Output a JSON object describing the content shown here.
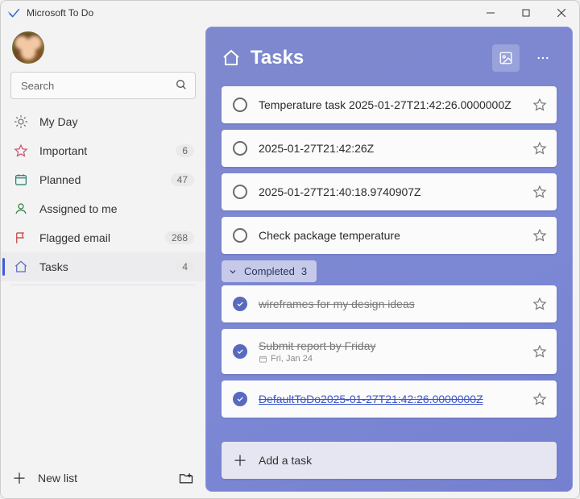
{
  "window": {
    "title": "Microsoft To Do"
  },
  "search": {
    "placeholder": "Search"
  },
  "sidebar": {
    "items": [
      {
        "icon": "sun",
        "label": "My Day",
        "count": ""
      },
      {
        "icon": "star",
        "label": "Important",
        "count": "6"
      },
      {
        "icon": "grid",
        "label": "Planned",
        "count": "47"
      },
      {
        "icon": "person",
        "label": "Assigned to me",
        "count": ""
      },
      {
        "icon": "flag",
        "label": "Flagged email",
        "count": "268"
      },
      {
        "icon": "home",
        "label": "Tasks",
        "count": "4"
      }
    ],
    "newList": "New list"
  },
  "main": {
    "title": "Tasks",
    "tasks": [
      {
        "title": "Temperature task 2025-01-27T21:42:26.0000000Z"
      },
      {
        "title": "2025-01-27T21:42:26Z"
      },
      {
        "title": "2025-01-27T21:40:18.9740907Z"
      },
      {
        "title": "Check package temperature"
      }
    ],
    "completedHeader": {
      "label": "Completed",
      "count": "3"
    },
    "completed": [
      {
        "title": "wireframes for my design ideas",
        "due": ""
      },
      {
        "title": "Submit report by Friday",
        "due": "Fri, Jan 24"
      },
      {
        "title": "DefaultToDo2025-01-27T21:42:26.0000000Z",
        "due": "",
        "link": true
      }
    ],
    "addTask": "Add a task"
  },
  "colors": {
    "sidebarActive": "#3b5bdb",
    "panel": "#7c88d4",
    "check": "#5968c0"
  }
}
